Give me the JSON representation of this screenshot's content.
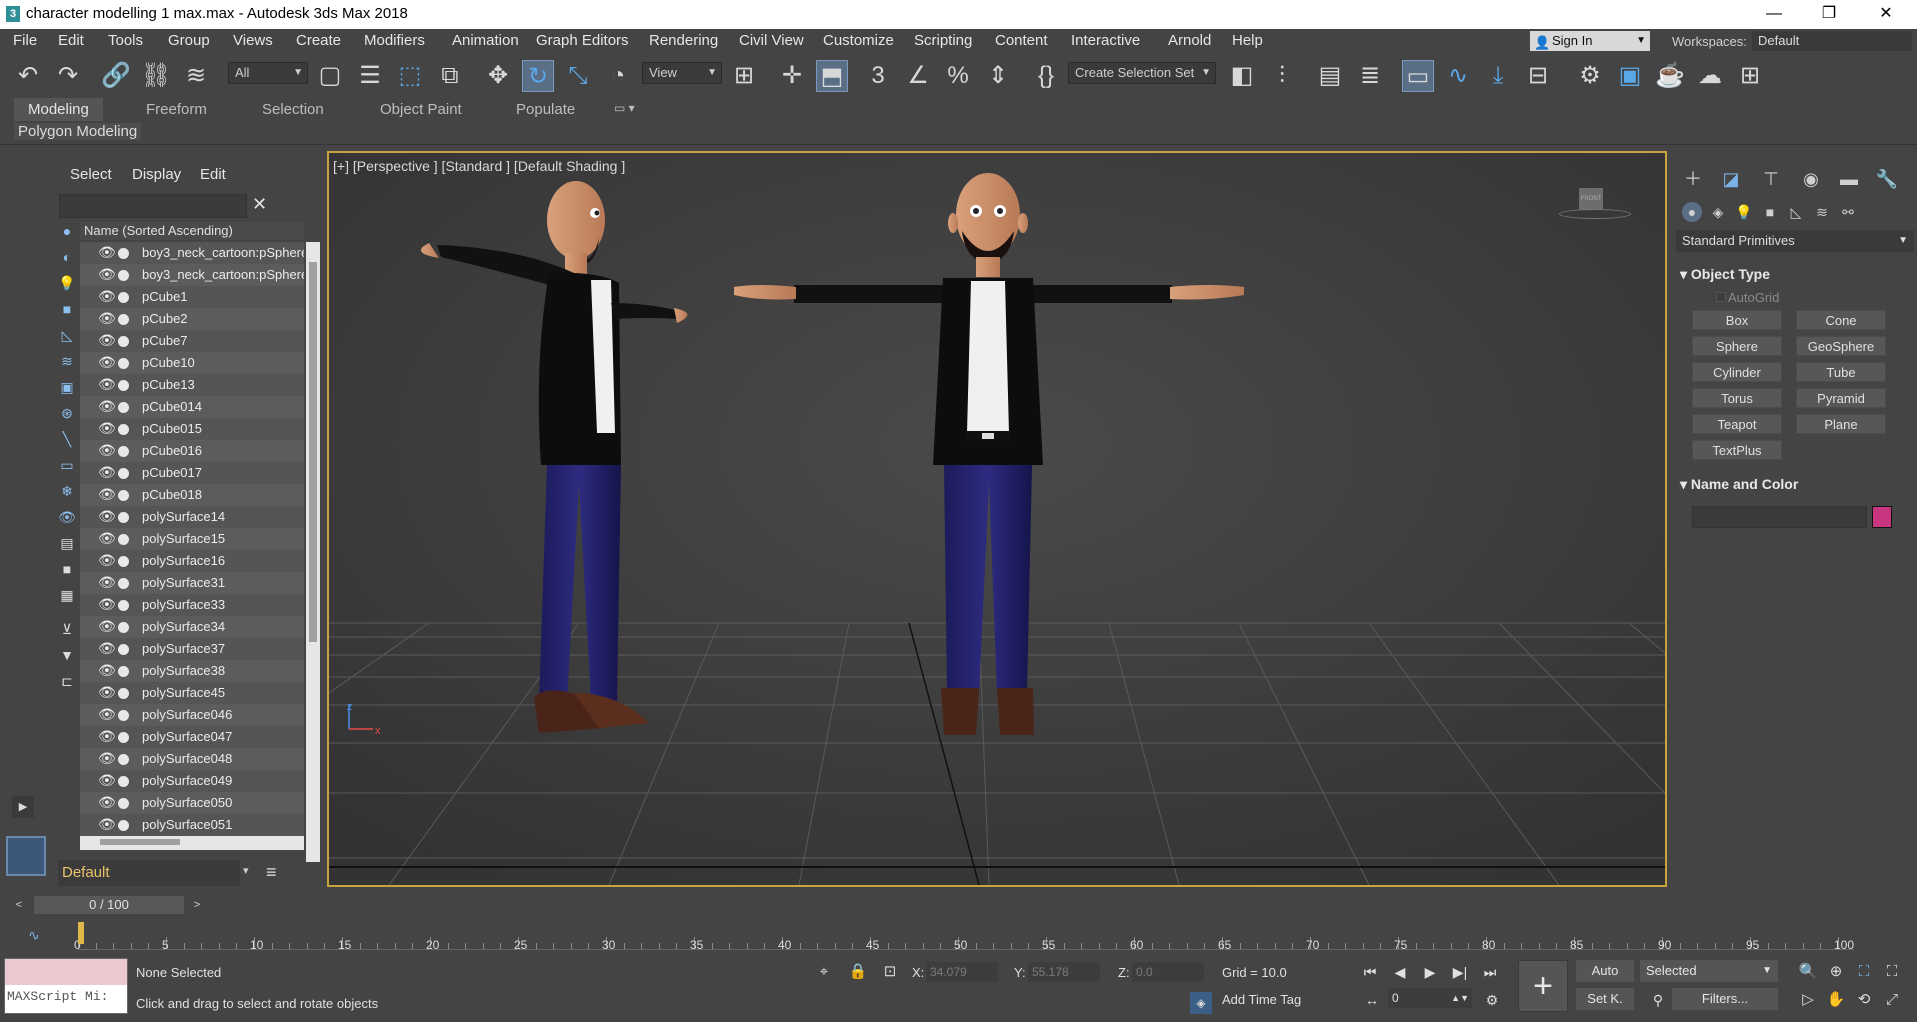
{
  "window": {
    "title": "character modelling 1 max.max - Autodesk 3ds Max 2018",
    "app_icon": "3",
    "minimize": "—",
    "maximize": "❐",
    "close": "✕"
  },
  "menu": [
    "File",
    "Edit",
    "Tools",
    "Group",
    "Views",
    "Create",
    "Modifiers",
    "Animation",
    "Graph Editors",
    "Rendering",
    "Civil View",
    "Customize",
    "Scripting",
    "Content",
    "Interactive",
    "Arnold",
    "Help"
  ],
  "account": {
    "sign_in": "Sign In",
    "workspaces_label": "Workspaces:",
    "workspace_value": "Default"
  },
  "toolbar": {
    "selection_filter": "All",
    "ref_coord": "View",
    "named_selection": "Create Selection Set"
  },
  "ribbon": {
    "tabs": [
      "Modeling",
      "Freeform",
      "Selection",
      "Object Paint",
      "Populate"
    ],
    "active_tab": "Modeling",
    "sub_label": "Polygon Modeling"
  },
  "scene_explorer": {
    "menu": [
      "Select",
      "Display",
      "Edit"
    ],
    "search_placeholder": "",
    "header": "Name (Sorted Ascending)",
    "items": [
      "boy3_neck_cartoon:pSphere",
      "boy3_neck_cartoon:pSphere",
      "pCube1",
      "pCube2",
      "pCube7",
      "pCube10",
      "pCube13",
      "pCube014",
      "pCube015",
      "pCube016",
      "pCube017",
      "pCube018",
      "polySurface14",
      "polySurface15",
      "polySurface16",
      "polySurface31",
      "polySurface33",
      "polySurface34",
      "polySurface37",
      "polySurface38",
      "polySurface45",
      "polySurface046",
      "polySurface047",
      "polySurface048",
      "polySurface049",
      "polySurface050",
      "polySurface051"
    ],
    "layer": "Default"
  },
  "viewport": {
    "label": "[+] [Perspective ] [Standard ] [Default Shading ]",
    "viewcube_face": "FRONT",
    "axis_x": "x",
    "axis_z": "z"
  },
  "command_panel": {
    "category": "Standard Primitives",
    "object_type_title": "Object Type",
    "autogrid": "AutoGrid",
    "primitives": [
      "Box",
      "Cone",
      "Sphere",
      "GeoSphere",
      "Cylinder",
      "Tube",
      "Torus",
      "Pyramid",
      "Teapot",
      "Plane",
      "TextPlus"
    ],
    "name_color_title": "Name and Color",
    "object_color": "#c8367f"
  },
  "time": {
    "slider": "0 / 100",
    "ticks": [
      "0",
      "5",
      "10",
      "15",
      "20",
      "25",
      "30",
      "35",
      "40",
      "45",
      "50",
      "55",
      "60",
      "65",
      "70",
      "75",
      "80",
      "85",
      "90",
      "95",
      "100"
    ]
  },
  "status": {
    "maxscript": "MAXScript Mi:",
    "selection": "None Selected",
    "prompt": "Click and drag to select and rotate objects",
    "x_label": "X:",
    "x_value": "34.079",
    "y_label": "Y:",
    "y_value": "55.178",
    "z_label": "Z:",
    "z_value": "0.0",
    "grid": "Grid = 10.0",
    "add_time_tag": "Add Time Tag",
    "auto": "Auto",
    "set_key": "Set K.",
    "key_filter": "Selected",
    "filters": "Filters...",
    "frame": "0"
  },
  "colors": {
    "viewport_border": "#c8a43c",
    "accent": "#5a6e86"
  }
}
